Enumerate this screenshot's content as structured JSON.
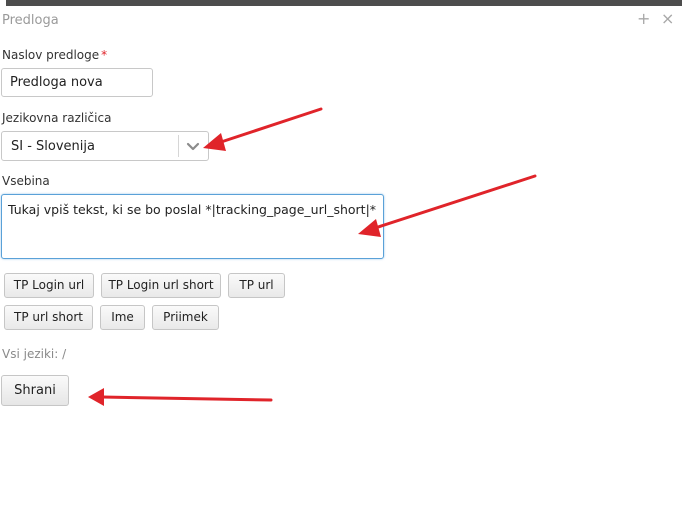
{
  "window": {
    "title": "Predloga",
    "maximize_icon": "plus-icon",
    "close_icon": "close-icon"
  },
  "form": {
    "title_label": "Naslov predloge",
    "required_mark": "*",
    "title_value": "Predloga nova",
    "language_label": "Jezikovna različica",
    "language_value": "SI - Slovenija",
    "content_label": "Vsebina",
    "content_value": "Tukaj vpiš tekst, ki se bo poslal *|tracking_page_url_short|*",
    "insert_buttons": [
      "TP Login url",
      "TP Login url short",
      "TP url",
      "TP url short",
      "Ime",
      "Priimek"
    ],
    "all_languages_text": "Vsi jeziki: /",
    "save_label": "Shrani"
  },
  "annotations": {
    "arrow_color": "#e0242a"
  },
  "colors": {
    "accent_focus": "#5aa1d8",
    "required": "#e0242a"
  }
}
